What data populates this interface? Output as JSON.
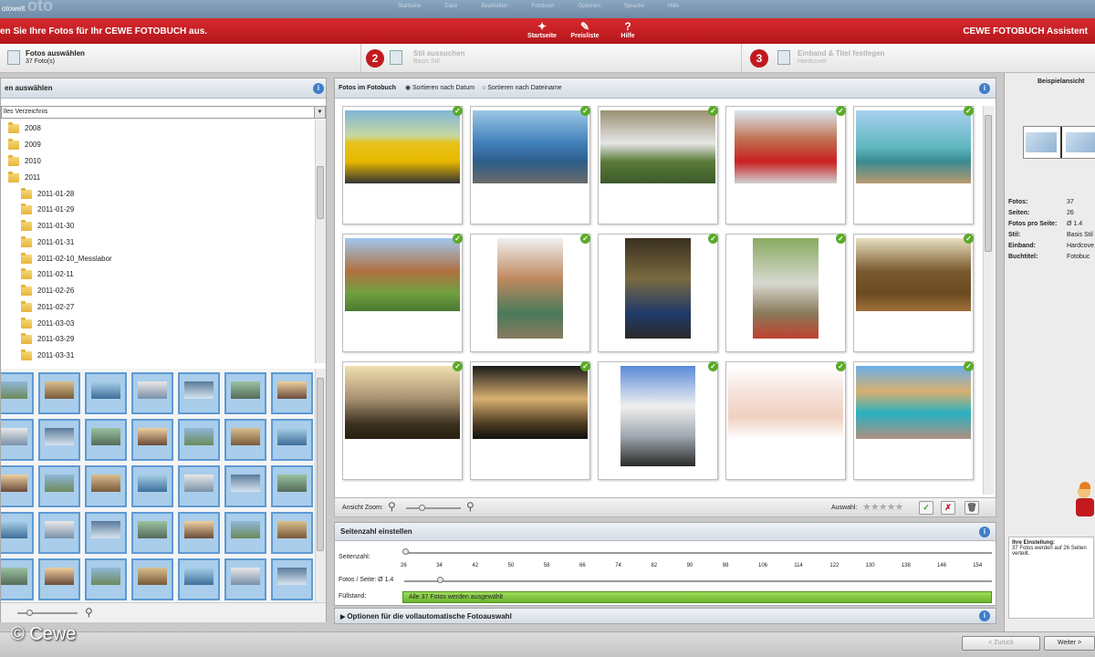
{
  "window": {
    "title": "otowelt",
    "logo_text": "oto",
    "menu": [
      "Startseite",
      "Datei",
      "Bearbeiten",
      "Fotobuch",
      "Optionen",
      "Sprache",
      "Hilfe"
    ]
  },
  "header": {
    "message": "en Sie Ihre Fotos für Ihr CEWE FOTOBUCH aus.",
    "brand": "CEWE FOTOBUCH Assistent",
    "toolbar": [
      {
        "label": "Startseite",
        "icon": "star-wand-icon"
      },
      {
        "label": "Preisliste",
        "icon": "price-list-icon"
      },
      {
        "label": "Hilfe",
        "icon": "help-icon"
      }
    ]
  },
  "steps": [
    {
      "number": "",
      "title": "Fotos auswählen",
      "subtitle": "37 Foto(s)"
    },
    {
      "number": "2",
      "title": "Stil aussuchen",
      "subtitle": "Basis Stil"
    },
    {
      "number": "3",
      "title": "Einband & Titel festlegen",
      "subtitle": "Hardcover"
    }
  ],
  "left": {
    "title": "en auswählen",
    "directory": "lles Verzeichnis",
    "tree": [
      {
        "label": "2008",
        "level": 0
      },
      {
        "label": "2009",
        "level": 0
      },
      {
        "label": "2010",
        "level": 0
      },
      {
        "label": "2011",
        "level": 0
      },
      {
        "label": "2011-01-28",
        "level": 1
      },
      {
        "label": "2011-01-29",
        "level": 1
      },
      {
        "label": "2011-01-30",
        "level": 1
      },
      {
        "label": "2011-01-31",
        "level": 1
      },
      {
        "label": "2011-02-10_Messlabor",
        "level": 1
      },
      {
        "label": "2011-02-11",
        "level": 1
      },
      {
        "label": "2011-02-26",
        "level": 1
      },
      {
        "label": "2011-02-27",
        "level": 1
      },
      {
        "label": "2011-03-03",
        "level": 1
      },
      {
        "label": "2011-03-29",
        "level": 1
      },
      {
        "label": "2011-03-31",
        "level": 1
      }
    ]
  },
  "center": {
    "title": "Fotos im Fotobuch",
    "sort_date": "Sortieren nach Datum",
    "sort_name": "Sortieren nach Dateiname",
    "zoom_label": "Ansicht Zoom:",
    "selection_label": "Auswahl:"
  },
  "pages": {
    "title": "Seitenzahl einstellen",
    "pages_label": "Seitenzahl:",
    "ticks": [
      "26",
      "34",
      "42",
      "50",
      "58",
      "66",
      "74",
      "82",
      "90",
      "98",
      "106",
      "114",
      "122",
      "130",
      "138",
      "146",
      "154"
    ],
    "per_page_label": "Fotos / Seite:  Ø 1.4",
    "fill_label": "Füllstand:",
    "fill_text": "Alle 37 Fotos werden ausgewählt"
  },
  "options": {
    "title": "Optionen für die vollautomatische Fotoauswahl"
  },
  "right": {
    "title": "Beispielansicht",
    "stats": [
      {
        "k": "Fotos:",
        "v": "37"
      },
      {
        "k": "Seiten:",
        "v": "26"
      },
      {
        "k": "Fotos pro Seite:",
        "v": "Ø 1.4"
      },
      {
        "k": "Stil:",
        "v": "Basis Stil"
      },
      {
        "k": "Einband:",
        "v": "Hardcove"
      },
      {
        "k": "Buchtitel:",
        "v": "Fotobuc"
      }
    ],
    "setting_title": "Ihre Einstellung:",
    "setting_text": "37 Fotos werden auf 26 Seiten verteilt."
  },
  "footer": {
    "back": "< Zurück",
    "next": "Weiter >",
    "copyright": "© Cewe"
  },
  "colors": {
    "accent": "#c21a1f",
    "fill": "#7cc23a",
    "selected": "#5e9ad4"
  }
}
